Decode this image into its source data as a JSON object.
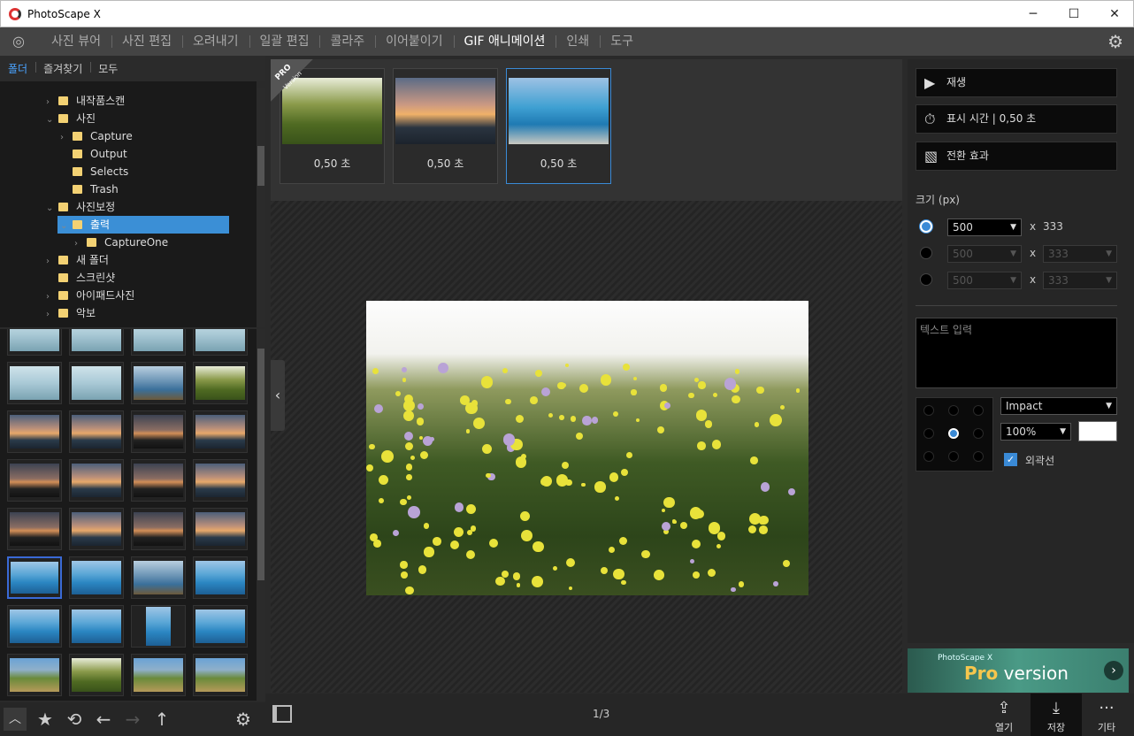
{
  "window": {
    "title": "PhotoScape X",
    "minimize": "─",
    "maximize": "☐",
    "close": "✕"
  },
  "menu": {
    "tabs": [
      "사진 뷰어",
      "사진 편집",
      "오려내기",
      "일괄 편집",
      "콜라주",
      "이어붙이기",
      "GIF 애니메이션",
      "인쇄",
      "도구"
    ],
    "active_tab": "GIF 애니메이션"
  },
  "left_tabs": [
    "폴더",
    "즐겨찾기",
    "모두"
  ],
  "tree": [
    {
      "label": "내작품스캔",
      "level": 1,
      "arrow": "›"
    },
    {
      "label": "사진",
      "level": 1,
      "arrow": "⌄"
    },
    {
      "label": "Capture",
      "level": 2,
      "arrow": "›"
    },
    {
      "label": "Output",
      "level": 2,
      "arrow": ""
    },
    {
      "label": "Selects",
      "level": 2,
      "arrow": ""
    },
    {
      "label": "Trash",
      "level": 2,
      "arrow": ""
    },
    {
      "label": "사진보정",
      "level": 1,
      "arrow": "⌄"
    },
    {
      "label": "출력",
      "level": 2,
      "arrow": "⌄",
      "selected": true
    },
    {
      "label": "CaptureOne",
      "level": 3,
      "arrow": "›"
    },
    {
      "label": "새 폴더",
      "level": 1,
      "arrow": "›"
    },
    {
      "label": "스크린샷",
      "level": 1,
      "arrow": ""
    },
    {
      "label": "아이패드사진",
      "level": 1,
      "arrow": "›"
    },
    {
      "label": "악보",
      "level": 1,
      "arrow": "›"
    }
  ],
  "frames": [
    {
      "duration": "0,50 초",
      "kind": "field"
    },
    {
      "duration": "0,50 초",
      "kind": "sunset"
    },
    {
      "duration": "0,50 초",
      "kind": "sea",
      "selected": true
    }
  ],
  "pro_badge": "PRO",
  "pro_badge_sub": "Version",
  "right": {
    "play": "재생",
    "display_time": "표시 시간 | 0,50 초",
    "transition": "전환 효과",
    "size_label": "크기 (px)",
    "size_rows": [
      {
        "w": "500",
        "x": "x",
        "h": "333",
        "enabled": true
      },
      {
        "w": "500",
        "x": "x",
        "h": "333",
        "enabled": false
      },
      {
        "w": "500",
        "x": "x",
        "h": "333",
        "enabled": false
      }
    ],
    "text_placeholder": "텍스트 입력",
    "font": "Impact",
    "opacity": "100%",
    "outline_label": "외곽선",
    "outline_checked": true,
    "text_color": "#ffffff"
  },
  "banner": {
    "small": "PhotoScape X",
    "pro": "Pro",
    "version": " version"
  },
  "bottom": {
    "page": "1/3",
    "open": "열기",
    "save": "저장",
    "more": "기타"
  },
  "colors": {
    "accent": "#3a8ad6",
    "folder": "#f3d173"
  }
}
